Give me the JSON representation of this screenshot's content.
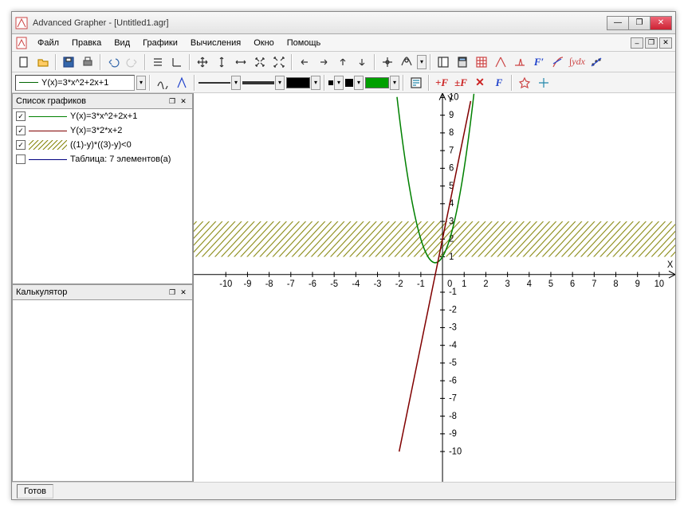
{
  "title": "Advanced Grapher - [Untitled1.agr]",
  "menu": {
    "file": "Файл",
    "edit": "Правка",
    "view": "Вид",
    "graphs": "Графики",
    "calc": "Вычисления",
    "window": "Окно",
    "help": "Помощь"
  },
  "formula_current": "Y(x)=3*x^2+2x+1",
  "panels": {
    "graphs_title": "Список графиков",
    "calc_title": "Калькулятор"
  },
  "graph_list": {
    "items": [
      {
        "checked": true,
        "color": "#008000",
        "label": "Y(x)=3*x^2+2x+1",
        "pattern": "line"
      },
      {
        "checked": true,
        "color": "#800000",
        "label": "Y(x)=3*2*x+2",
        "pattern": "line"
      },
      {
        "checked": true,
        "color": "#808000",
        "label": "((1)-y)*((3)-y)<0",
        "pattern": "hatch"
      },
      {
        "checked": false,
        "color": "#000080",
        "label": "Таблица: 7 элементов(а)",
        "pattern": "line"
      }
    ]
  },
  "status": "Готов",
  "colors": {
    "accent_green": "#00a000",
    "line_green": "#008000",
    "line_red": "#800000",
    "hatch": "#808000"
  },
  "chart_data": {
    "type": "line",
    "title": "",
    "xlabel": "X",
    "ylabel": "Y",
    "xlim": [
      -10,
      10
    ],
    "ylim": [
      -10,
      10
    ],
    "xticks": [
      -10,
      -9,
      -8,
      -7,
      -6,
      -5,
      -4,
      -3,
      -2,
      -1,
      0,
      1,
      2,
      3,
      4,
      5,
      6,
      7,
      8,
      9,
      10
    ],
    "yticks": [
      -10,
      -9,
      -8,
      -7,
      -6,
      -5,
      -4,
      -3,
      -2,
      -1,
      0,
      1,
      2,
      3,
      4,
      5,
      6,
      7,
      8,
      9,
      10
    ],
    "series": [
      {
        "name": "Y(x)=3*x^2+2x+1",
        "type": "function",
        "color": "#008000",
        "x": [
          -2.5,
          -2,
          -1.5,
          -1,
          -0.5,
          -0.333,
          0,
          0.5,
          1,
          1.5,
          2
        ],
        "y": [
          14.75,
          9,
          5.75,
          2,
          1.25,
          0.67,
          1,
          2.75,
          6,
          10.75,
          17
        ]
      },
      {
        "name": "Y(x)=3*2*x+2",
        "type": "function",
        "color": "#800000",
        "x": [
          -2,
          -1,
          0,
          1,
          2
        ],
        "y": [
          -10,
          -4,
          2,
          8,
          14
        ]
      },
      {
        "name": "1<y<3",
        "type": "region-y",
        "color": "#808000",
        "ymin": 1,
        "ymax": 3
      }
    ]
  }
}
